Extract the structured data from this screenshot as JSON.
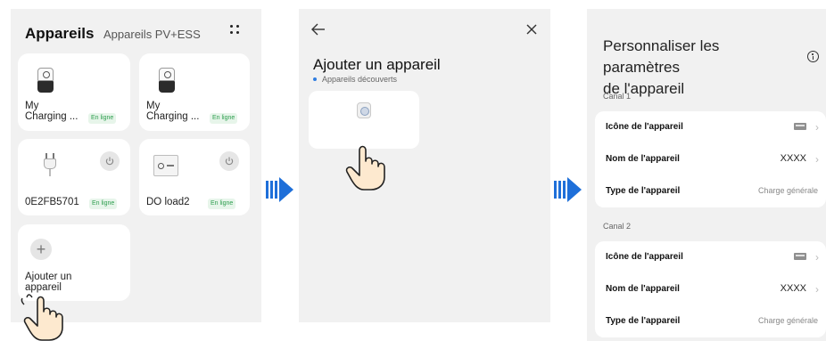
{
  "panel1": {
    "title": "Appareils",
    "tab": "Appareils PV+ESS",
    "devices": [
      {
        "name_line1": "My",
        "name_line2": "Charging ...",
        "status": "En ligne",
        "icon": "charger-icon"
      },
      {
        "name_line1": "My",
        "name_line2": "Charging ...",
        "status": "En ligne",
        "icon": "charger-icon"
      },
      {
        "name": "0E2FB5701",
        "status": "En ligne",
        "icon": "plug-icon",
        "power_icon": "power-icon"
      },
      {
        "name": "DO load2",
        "status": "En ligne",
        "icon": "load-switch-icon",
        "power_icon": "power-icon"
      }
    ],
    "add": {
      "icon": "plus",
      "label_line1": "Ajouter un",
      "label_line2": "appareil"
    }
  },
  "panel2": {
    "title": "Ajouter un appareil",
    "section": "Appareils découverts",
    "section_dot_color": "#2f7de1",
    "found_icon": "socket-icon"
  },
  "panel3": {
    "title_line1": "Personnaliser les paramètres",
    "title_line2": "de l'appareil",
    "channels": [
      {
        "label": "Canal 1",
        "rows": [
          {
            "label": "Icône de l'appareil",
            "value": ""
          },
          {
            "label": "Nom de l'appareil",
            "value": "XXXX"
          },
          {
            "label": "Type de l'appareil",
            "value": "Charge générale"
          }
        ]
      },
      {
        "label": "Canal 2",
        "rows": [
          {
            "label": "Icône de l'appareil",
            "value": ""
          },
          {
            "label": "Nom de l'appareil",
            "value": "XXXX"
          },
          {
            "label": "Type de l'appareil",
            "value": "Charge générale"
          }
        ]
      }
    ]
  },
  "colors": {
    "arrow": "#1e6fd9",
    "online": "#2e9e4f",
    "panel_bg": "#f1f1f1"
  }
}
